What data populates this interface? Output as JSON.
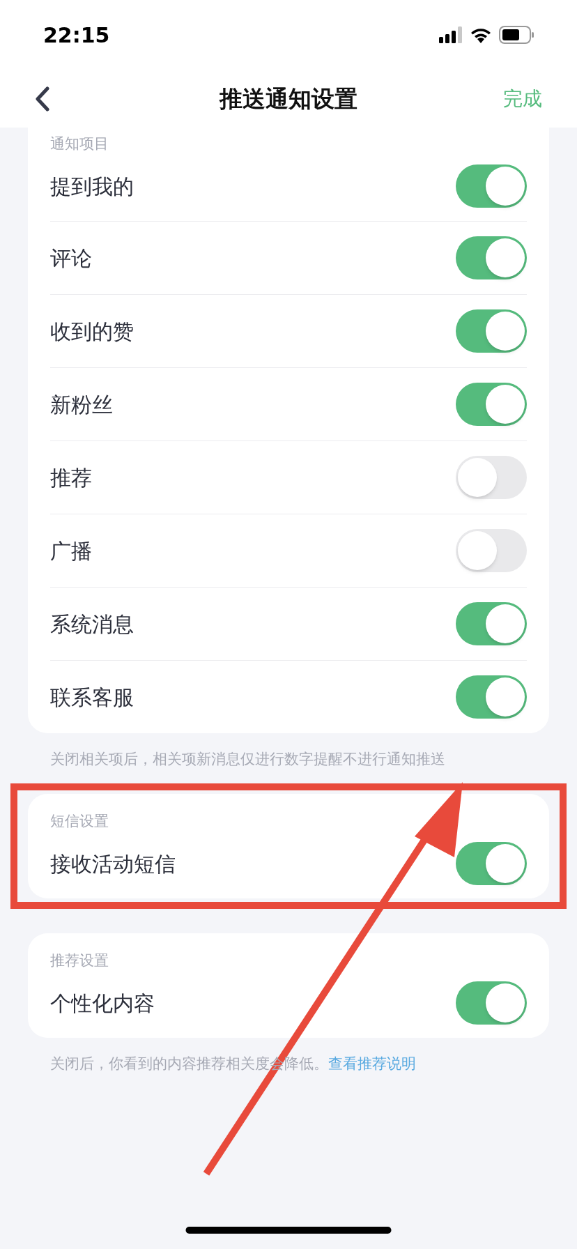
{
  "status_bar": {
    "time": "22:15"
  },
  "nav": {
    "title": "推送通知设置",
    "done": "完成"
  },
  "sections": [
    {
      "header": "通知项目",
      "items": [
        {
          "label": "提到我的",
          "on": true
        },
        {
          "label": "评论",
          "on": true
        },
        {
          "label": "收到的赞",
          "on": true
        },
        {
          "label": "新粉丝",
          "on": true
        },
        {
          "label": "推荐",
          "on": false
        },
        {
          "label": "广播",
          "on": false
        },
        {
          "label": "系统消息",
          "on": true
        },
        {
          "label": "联系客服",
          "on": true
        }
      ],
      "footnote": "关闭相关项后，相关项新消息仅进行数字提醒不进行通知推送"
    },
    {
      "header": "短信设置",
      "items": [
        {
          "label": "接收活动短信",
          "on": true
        }
      ],
      "annotation": {
        "kind": "frame"
      }
    },
    {
      "header": "推荐设置",
      "items": [
        {
          "label": "个性化内容",
          "on": true
        }
      ],
      "footnote": "关闭后，你看到的内容推荐相关度会降低。",
      "footnote_link": "查看推荐说明"
    }
  ]
}
